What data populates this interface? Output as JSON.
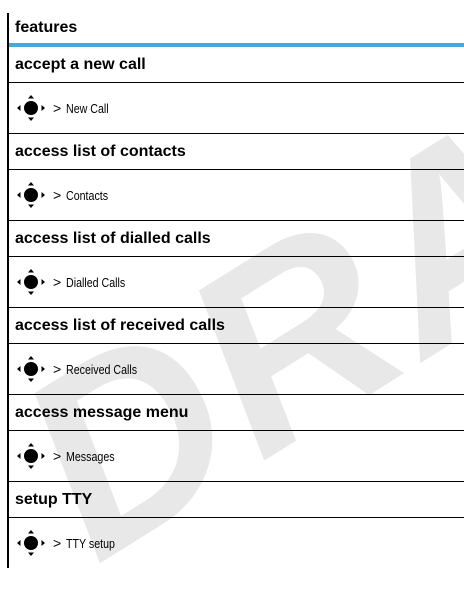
{
  "watermark": "DRAFT",
  "table": {
    "header": "features",
    "rows": [
      {
        "title": "accept a new call",
        "arrow": ">",
        "target": "New Call"
      },
      {
        "title": "access list of contacts",
        "arrow": ">",
        "target": "Contacts"
      },
      {
        "title": "access list of dialled calls",
        "arrow": ">",
        "target": "Dialled Calls"
      },
      {
        "title": "access list of received calls",
        "arrow": ">",
        "target": "Received Calls"
      },
      {
        "title": "access message menu",
        "arrow": ">",
        "target": "Messages"
      },
      {
        "title": "setup TTY",
        "arrow": ">",
        "target": "TTY setup"
      }
    ]
  },
  "icons": {
    "nav_key": "nav-key-icon"
  },
  "colors": {
    "header_rule": "#4aa7dc",
    "watermark": "#e8e8e8"
  }
}
